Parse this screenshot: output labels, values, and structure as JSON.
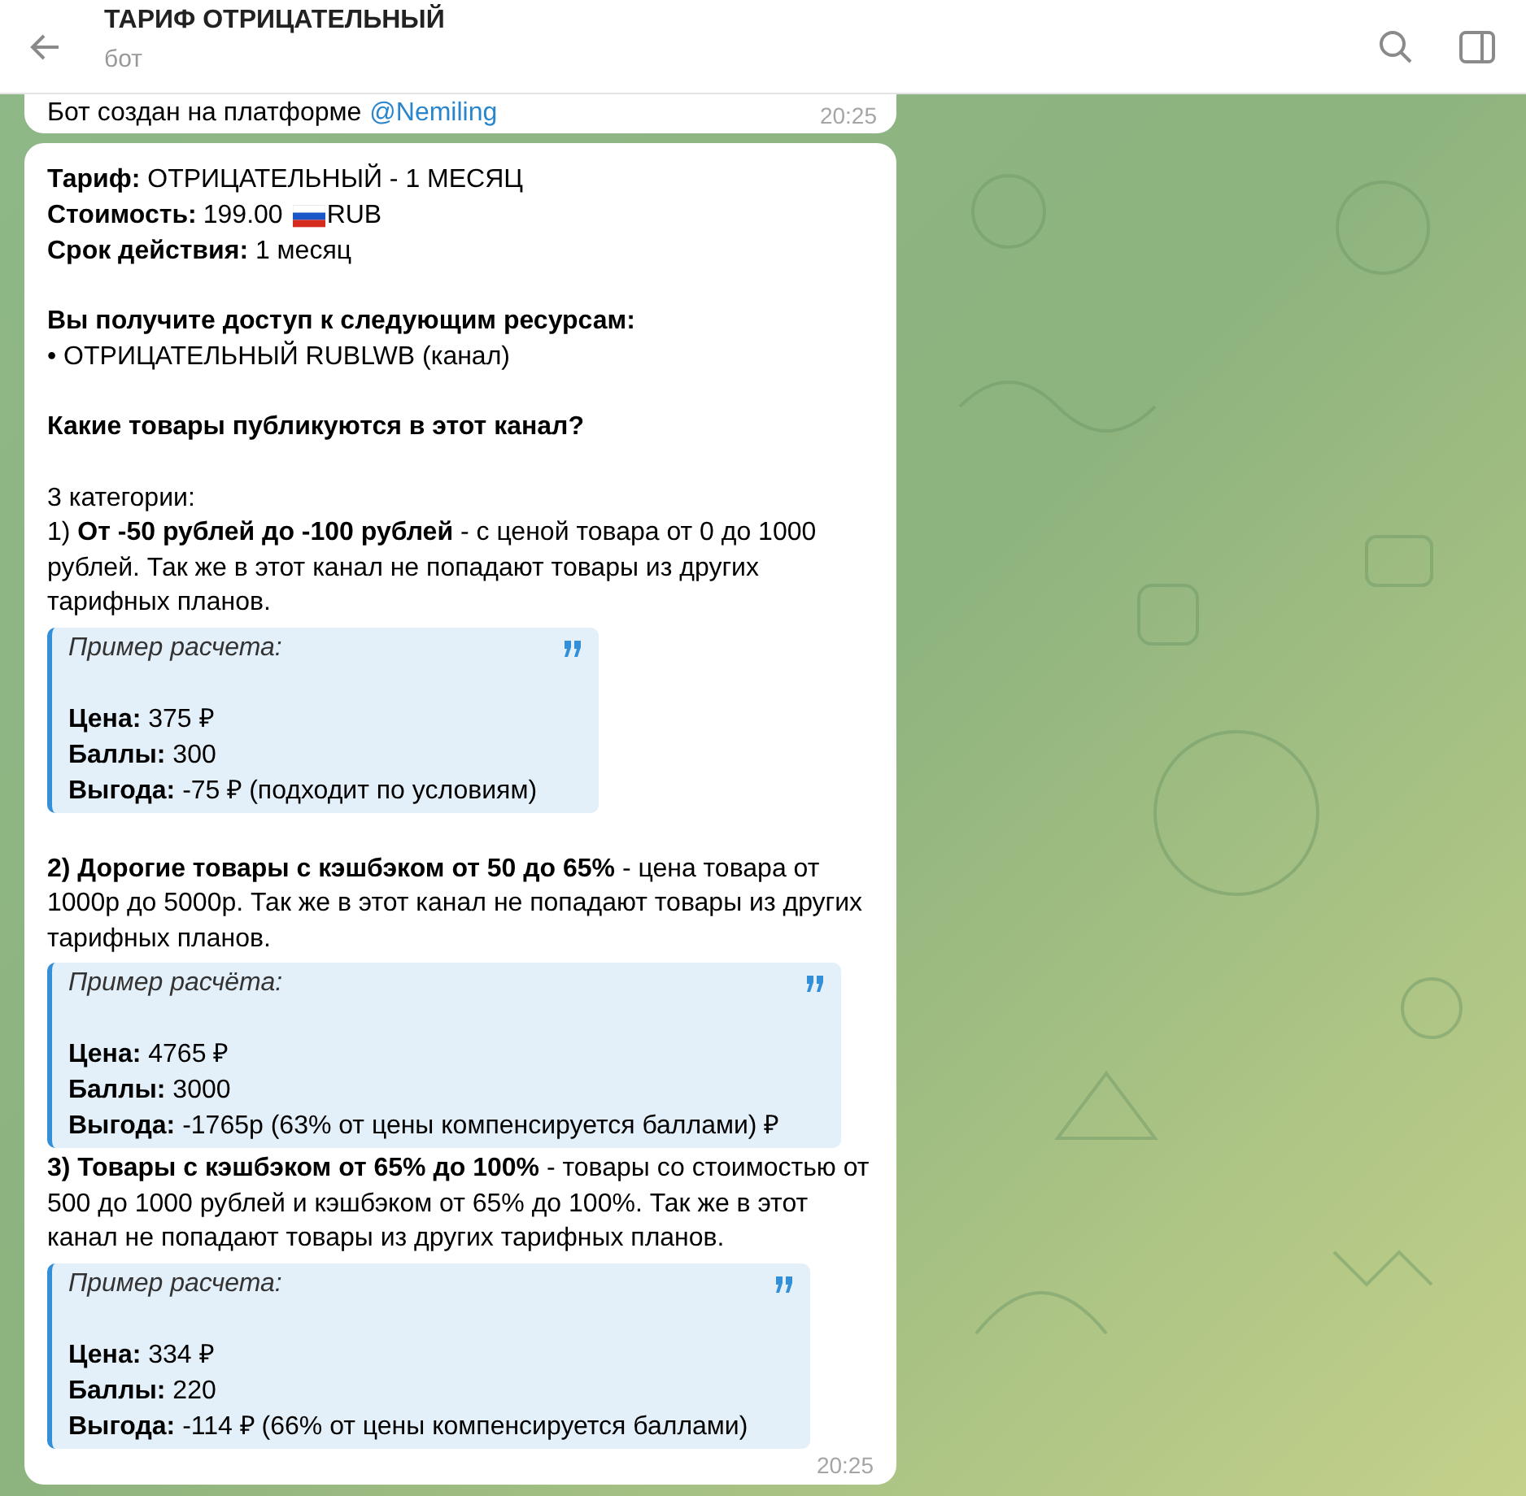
{
  "header": {
    "title": "ТАРИФ ОТРИЦАТЕЛЬНЫЙ",
    "subtitle": "бот"
  },
  "messages": [
    {
      "kind": "partial",
      "text": "Бот создан на платформе",
      "link": "@Nemiling",
      "time": "20:25"
    },
    {
      "kind": "full",
      "time": "20:25",
      "blocks": [
        {
          "kind": "text",
          "text": "**Тариф:** ОТРИЦАТЕЛЬНЫЙ - 1 МЕСЯЦ"
        },
        {
          "kind": "price",
          "label": "Стоимость:",
          "amount": "199.00",
          "currency": "RUB"
        },
        {
          "kind": "text",
          "text": "**Срок действия:** 1 месяц"
        },
        {
          "kind": "gap"
        },
        {
          "kind": "heading",
          "text": "Вы получите доступ к следующим ресурсам:"
        },
        {
          "kind": "text",
          "text": "• ОТРИЦАТЕЛЬНЫЙ RUBLWB (канал)"
        },
        {
          "kind": "gap"
        },
        {
          "kind": "heading",
          "text": "Какие товары публикуются в этот канал?"
        },
        {
          "kind": "gap"
        },
        {
          "kind": "text",
          "text": "3 категории:"
        },
        {
          "kind": "text",
          "text": "1) **От -50 рублей до -100 рублей** - с ценой товара от 0 до 1000 рублей. Так же в этот канал не попадают товары из других тарифных планов."
        },
        {
          "kind": "quote",
          "title": "Пример расчета:",
          "lines": [
            "**Цена:** 375 ₽",
            "**Баллы:** 300",
            "**Выгода:** -75 ₽ (подходит по условиям)"
          ]
        },
        {
          "kind": "gap"
        },
        {
          "kind": "text",
          "text": "**2) Дорогие товары с кэшбэком от 50 до 65%** - цена товара от 1000р до 5000р. Так же в этот канал не попадают товары из других тарифных планов."
        },
        {
          "kind": "quote",
          "title": "Пример расчёта:",
          "lines": [
            "**Цена:** 4765 ₽",
            "**Баллы:** 3000",
            "**Выгода:** -1765р (63% от цены компенсируется баллами) ₽"
          ]
        },
        {
          "kind": "text",
          "text": "**3) Товары с кэшбэком от 65% до 100%** - товары со стоимостью от 500 до 1000 рублей и кэшбэком от 65% до 100%. Так же в этот канал не попадают товары из других тарифных планов."
        },
        {
          "kind": "quote",
          "title": "Пример расчета:",
          "lines": [
            "**Цена:** 334 ₽",
            "**Баллы:** 220",
            "**Выгода:** -114 ₽ (66% от цены компенсируется баллами)"
          ]
        }
      ]
    }
  ]
}
